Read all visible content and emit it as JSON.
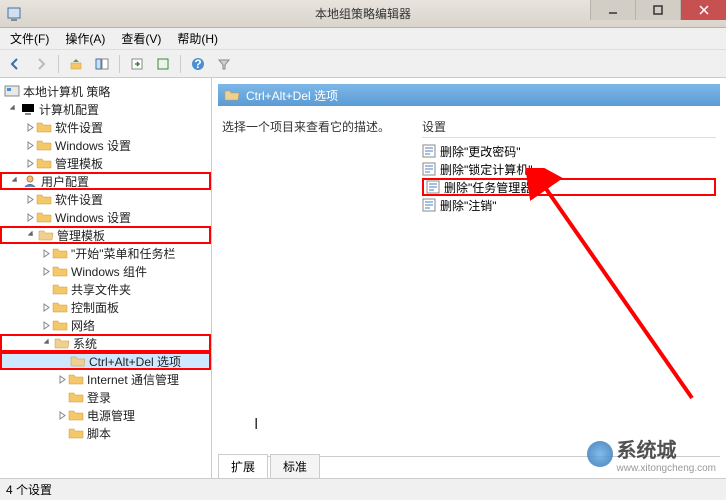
{
  "window": {
    "title": "本地组策略编辑器"
  },
  "menu": {
    "file": "文件(F)",
    "action": "操作(A)",
    "view": "查看(V)",
    "help": "帮助(H)"
  },
  "tree": {
    "root": "本地计算机 策略",
    "computer_config": "计算机配置",
    "cc_software": "软件设置",
    "cc_windows": "Windows 设置",
    "cc_templates": "管理模板",
    "user_config": "用户配置",
    "uc_software": "软件设置",
    "uc_windows": "Windows 设置",
    "uc_templates": "管理模板",
    "start_taskbar": "\"开始\"菜单和任务栏",
    "win_components": "Windows 组件",
    "shared_folders": "共享文件夹",
    "control_panel": "控制面板",
    "network": "网络",
    "system": "系统",
    "ctrl_alt_del": "Ctrl+Alt+Del 选项",
    "internet_mgmt": "Internet 通信管理",
    "login": "登录",
    "power": "电源管理",
    "script": "脚本"
  },
  "rightpane": {
    "header": "Ctrl+Alt+Del 选项",
    "hint": "选择一个项目来查看它的描述。",
    "col_setting": "设置",
    "items": {
      "remove_change_pwd": "删除\"更改密码\"",
      "remove_lock": "删除\"锁定计算机\"",
      "remove_taskmgr": "删除\"任务管理器\"",
      "remove_logoff": "删除\"注销\""
    }
  },
  "tabs": {
    "extended": "扩展",
    "standard": "标准"
  },
  "status": "4 个设置",
  "watermark": {
    "text": "系统城",
    "sub": "www.xitongcheng.com"
  }
}
